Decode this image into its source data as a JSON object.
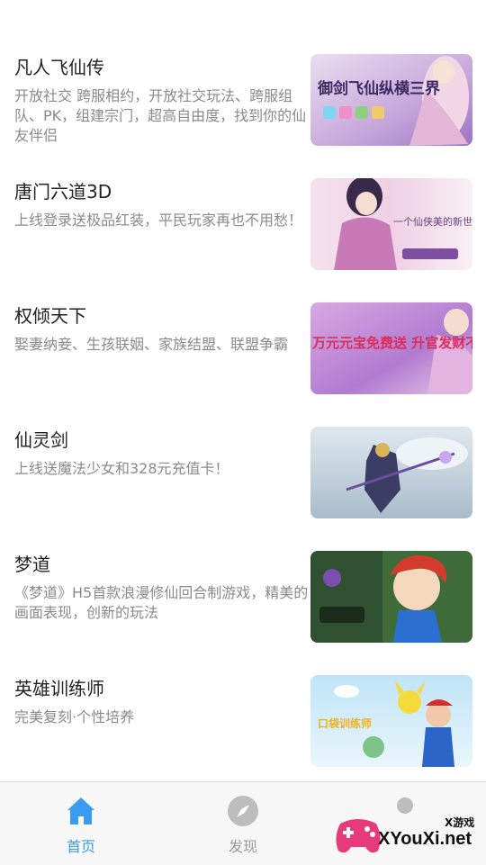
{
  "games": [
    {
      "title": "凡人飞仙传",
      "desc": "开放社交 跨服相约，开放社交玩法、跨服组队、PK，组建宗门，超高自由度，找到你的仙友伴侣",
      "image_text": "御剑飞仙纵横三界"
    },
    {
      "title": "唐门六道3D",
      "desc": "上线登录送极品红装，平民玩家再也不用愁！",
      "image_text": "一个仙侠美的新世界"
    },
    {
      "title": "权倾天下",
      "desc": "娶妻纳妾、生孩联姻、家族结盟、联盟争霸",
      "image_text": "万元元宝免费送 升官发财不是梦"
    },
    {
      "title": "仙灵剑",
      "desc": "上线送魔法少女和328元充值卡！",
      "image_text": ""
    },
    {
      "title": "梦道",
      "desc": "《梦道》H5首款浪漫修仙回合制游戏，精美的画面表现，创新的玩法",
      "image_text": ""
    },
    {
      "title": "英雄训练师",
      "desc": "完美复刻·个性培养",
      "image_text": "口袋训练师"
    }
  ],
  "tabbar": {
    "home_label": "首页",
    "discover_label": "发现",
    "active_color": "#3a9bf0",
    "inactive_color": "#9a9a9a"
  },
  "watermark": {
    "small": "X游戏",
    "big": "XYouXi.net"
  }
}
